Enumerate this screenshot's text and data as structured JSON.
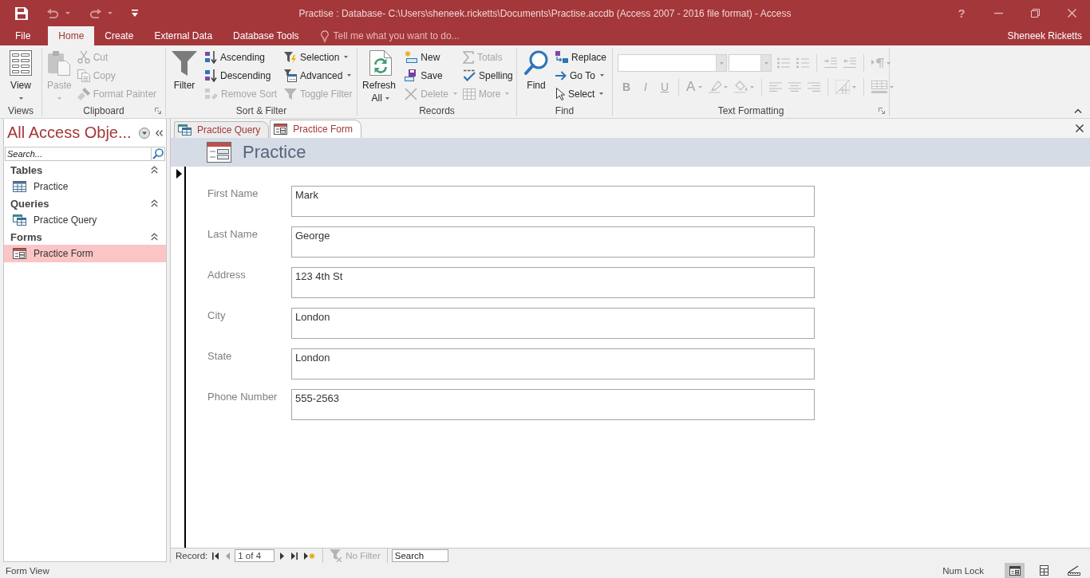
{
  "title_bar": {
    "quick_access": [
      {
        "kind": "save",
        "disabled": false
      },
      {
        "kind": "undo",
        "disabled": true
      },
      {
        "kind": "redo",
        "disabled": true
      },
      {
        "kind": "customize",
        "disabled": false
      }
    ],
    "title": "Practise : Database- C:\\Users\\sheneek.ricketts\\Documents\\Practise.accdb (Access 2007 - 2016 file format) - Access",
    "help": "?"
  },
  "ribbon_tabs": [
    {
      "label": "File",
      "selected": false
    },
    {
      "label": "Home",
      "selected": true
    },
    {
      "label": "Create",
      "selected": false
    },
    {
      "label": "External Data",
      "selected": false
    },
    {
      "label": "Database Tools",
      "selected": false
    }
  ],
  "tell_me": {
    "placeholder": "Tell me what you want to do..."
  },
  "user": "Sheneek Ricketts",
  "ribbon": {
    "groups": [
      {
        "label": "Views",
        "kind": "buttons",
        "launcher": false,
        "columns": [
          {
            "kind": "large",
            "items": [
              {
                "label": "View",
                "dropdown": true,
                "disabled": false
              }
            ]
          }
        ]
      },
      {
        "label": "Clipboard",
        "kind": "buttons",
        "launcher": true,
        "columns": [
          {
            "kind": "large",
            "items": [
              {
                "label": "Paste",
                "dropdown": true,
                "disabled": true
              }
            ]
          },
          {
            "kind": "small",
            "items": [
              {
                "label": "Cut",
                "dropdown": false,
                "disabled": true
              },
              {
                "label": "Copy",
                "dropdown": false,
                "disabled": true
              },
              {
                "label": "Format Painter",
                "dropdown": false,
                "disabled": true
              }
            ]
          }
        ]
      },
      {
        "label": "Sort & Filter",
        "kind": "buttons",
        "launcher": false,
        "columns": [
          {
            "kind": "large",
            "items": [
              {
                "label": "Filter",
                "dropdown": false,
                "disabled": false
              }
            ]
          },
          {
            "kind": "small",
            "items": [
              {
                "label": "Ascending",
                "dropdown": false,
                "disabled": false
              },
              {
                "label": "Descending",
                "dropdown": false,
                "disabled": false
              },
              {
                "label": "Remove Sort",
                "dropdown": false,
                "disabled": true
              }
            ]
          },
          {
            "kind": "small",
            "items": [
              {
                "label": "Selection",
                "dropdown": true,
                "disabled": false
              },
              {
                "label": "Advanced",
                "dropdown": true,
                "disabled": false
              },
              {
                "label": "Toggle Filter",
                "dropdown": false,
                "disabled": true
              }
            ]
          }
        ]
      },
      {
        "label": "Records",
        "kind": "buttons",
        "launcher": false,
        "columns": [
          {
            "kind": "large",
            "items": [
              {
                "label": "Refresh All",
                "dropdown": true,
                "disabled": false
              }
            ]
          },
          {
            "kind": "small",
            "items": [
              {
                "label": "New",
                "dropdown": false,
                "disabled": false
              },
              {
                "label": "Save",
                "dropdown": false,
                "disabled": false
              },
              {
                "label": "Delete",
                "dropdown": true,
                "disabled": true
              }
            ]
          },
          {
            "kind": "small",
            "items": [
              {
                "label": "Totals",
                "dropdown": false,
                "disabled": true
              },
              {
                "label": "Spelling",
                "dropdown": false,
                "disabled": false
              },
              {
                "label": "More",
                "dropdown": true,
                "disabled": true
              }
            ]
          }
        ]
      },
      {
        "label": "Find",
        "kind": "buttons",
        "launcher": false,
        "columns": [
          {
            "kind": "large",
            "items": [
              {
                "label": "Find",
                "dropdown": false,
                "disabled": false
              }
            ]
          },
          {
            "kind": "small",
            "items": [
              {
                "label": "Replace",
                "dropdown": false,
                "disabled": false
              },
              {
                "label": "Go To",
                "dropdown": true,
                "disabled": false
              },
              {
                "label": "Select",
                "dropdown": true,
                "disabled": false
              }
            ]
          }
        ]
      },
      {
        "label": "Text Formatting",
        "kind": "format",
        "launcher": true,
        "disabled": true,
        "letter_buttons": [
          {
            "label": "B"
          },
          {
            "label": "I"
          },
          {
            "label": "U"
          },
          {
            "label": "A"
          }
        ]
      }
    ]
  },
  "navigation_pane": {
    "title": "All Access Obje...",
    "search": {
      "placeholder": "Search..."
    },
    "groups": [
      {
        "label": "Tables",
        "kind": "table",
        "expanded": true,
        "items": [
          {
            "label": "Practice",
            "selected": false
          }
        ]
      },
      {
        "label": "Queries",
        "kind": "query",
        "expanded": true,
        "items": [
          {
            "label": "Practice Query",
            "selected": false
          }
        ]
      },
      {
        "label": "Forms",
        "kind": "form",
        "expanded": true,
        "items": [
          {
            "label": "Practice Form",
            "selected": true
          }
        ]
      }
    ]
  },
  "document_tabs": [
    {
      "label": "Practice Query",
      "kind": "query",
      "selected": false
    },
    {
      "label": "Practice Form",
      "kind": "form",
      "selected": true
    }
  ],
  "form": {
    "title": "Practice",
    "fields": [
      {
        "label": "First Name",
        "value": "Mark"
      },
      {
        "label": "Last Name",
        "value": "George"
      },
      {
        "label": "Address",
        "value": "123 4th St"
      },
      {
        "label": "City",
        "value": "London"
      },
      {
        "label": "State",
        "value": "London"
      },
      {
        "label": "Phone Number",
        "value": "555-2563"
      }
    ]
  },
  "record_navigation": {
    "label": "Record:",
    "position": "1 of 4",
    "buttons": [
      {
        "kind": "first",
        "disabled": false
      },
      {
        "kind": "previous",
        "disabled": true
      },
      {
        "kind": "next",
        "disabled": false
      },
      {
        "kind": "last",
        "disabled": false
      },
      {
        "kind": "new",
        "disabled": false
      }
    ],
    "filter": {
      "label": "No Filter",
      "disabled": true
    },
    "search": {
      "placeholder": "Search"
    }
  },
  "status_bar": {
    "text": "Form View",
    "indicators": [
      "Num Lock"
    ],
    "views": [
      {
        "kind": "form",
        "selected": true
      },
      {
        "kind": "layout",
        "selected": false
      },
      {
        "kind": "design",
        "selected": false
      }
    ]
  }
}
